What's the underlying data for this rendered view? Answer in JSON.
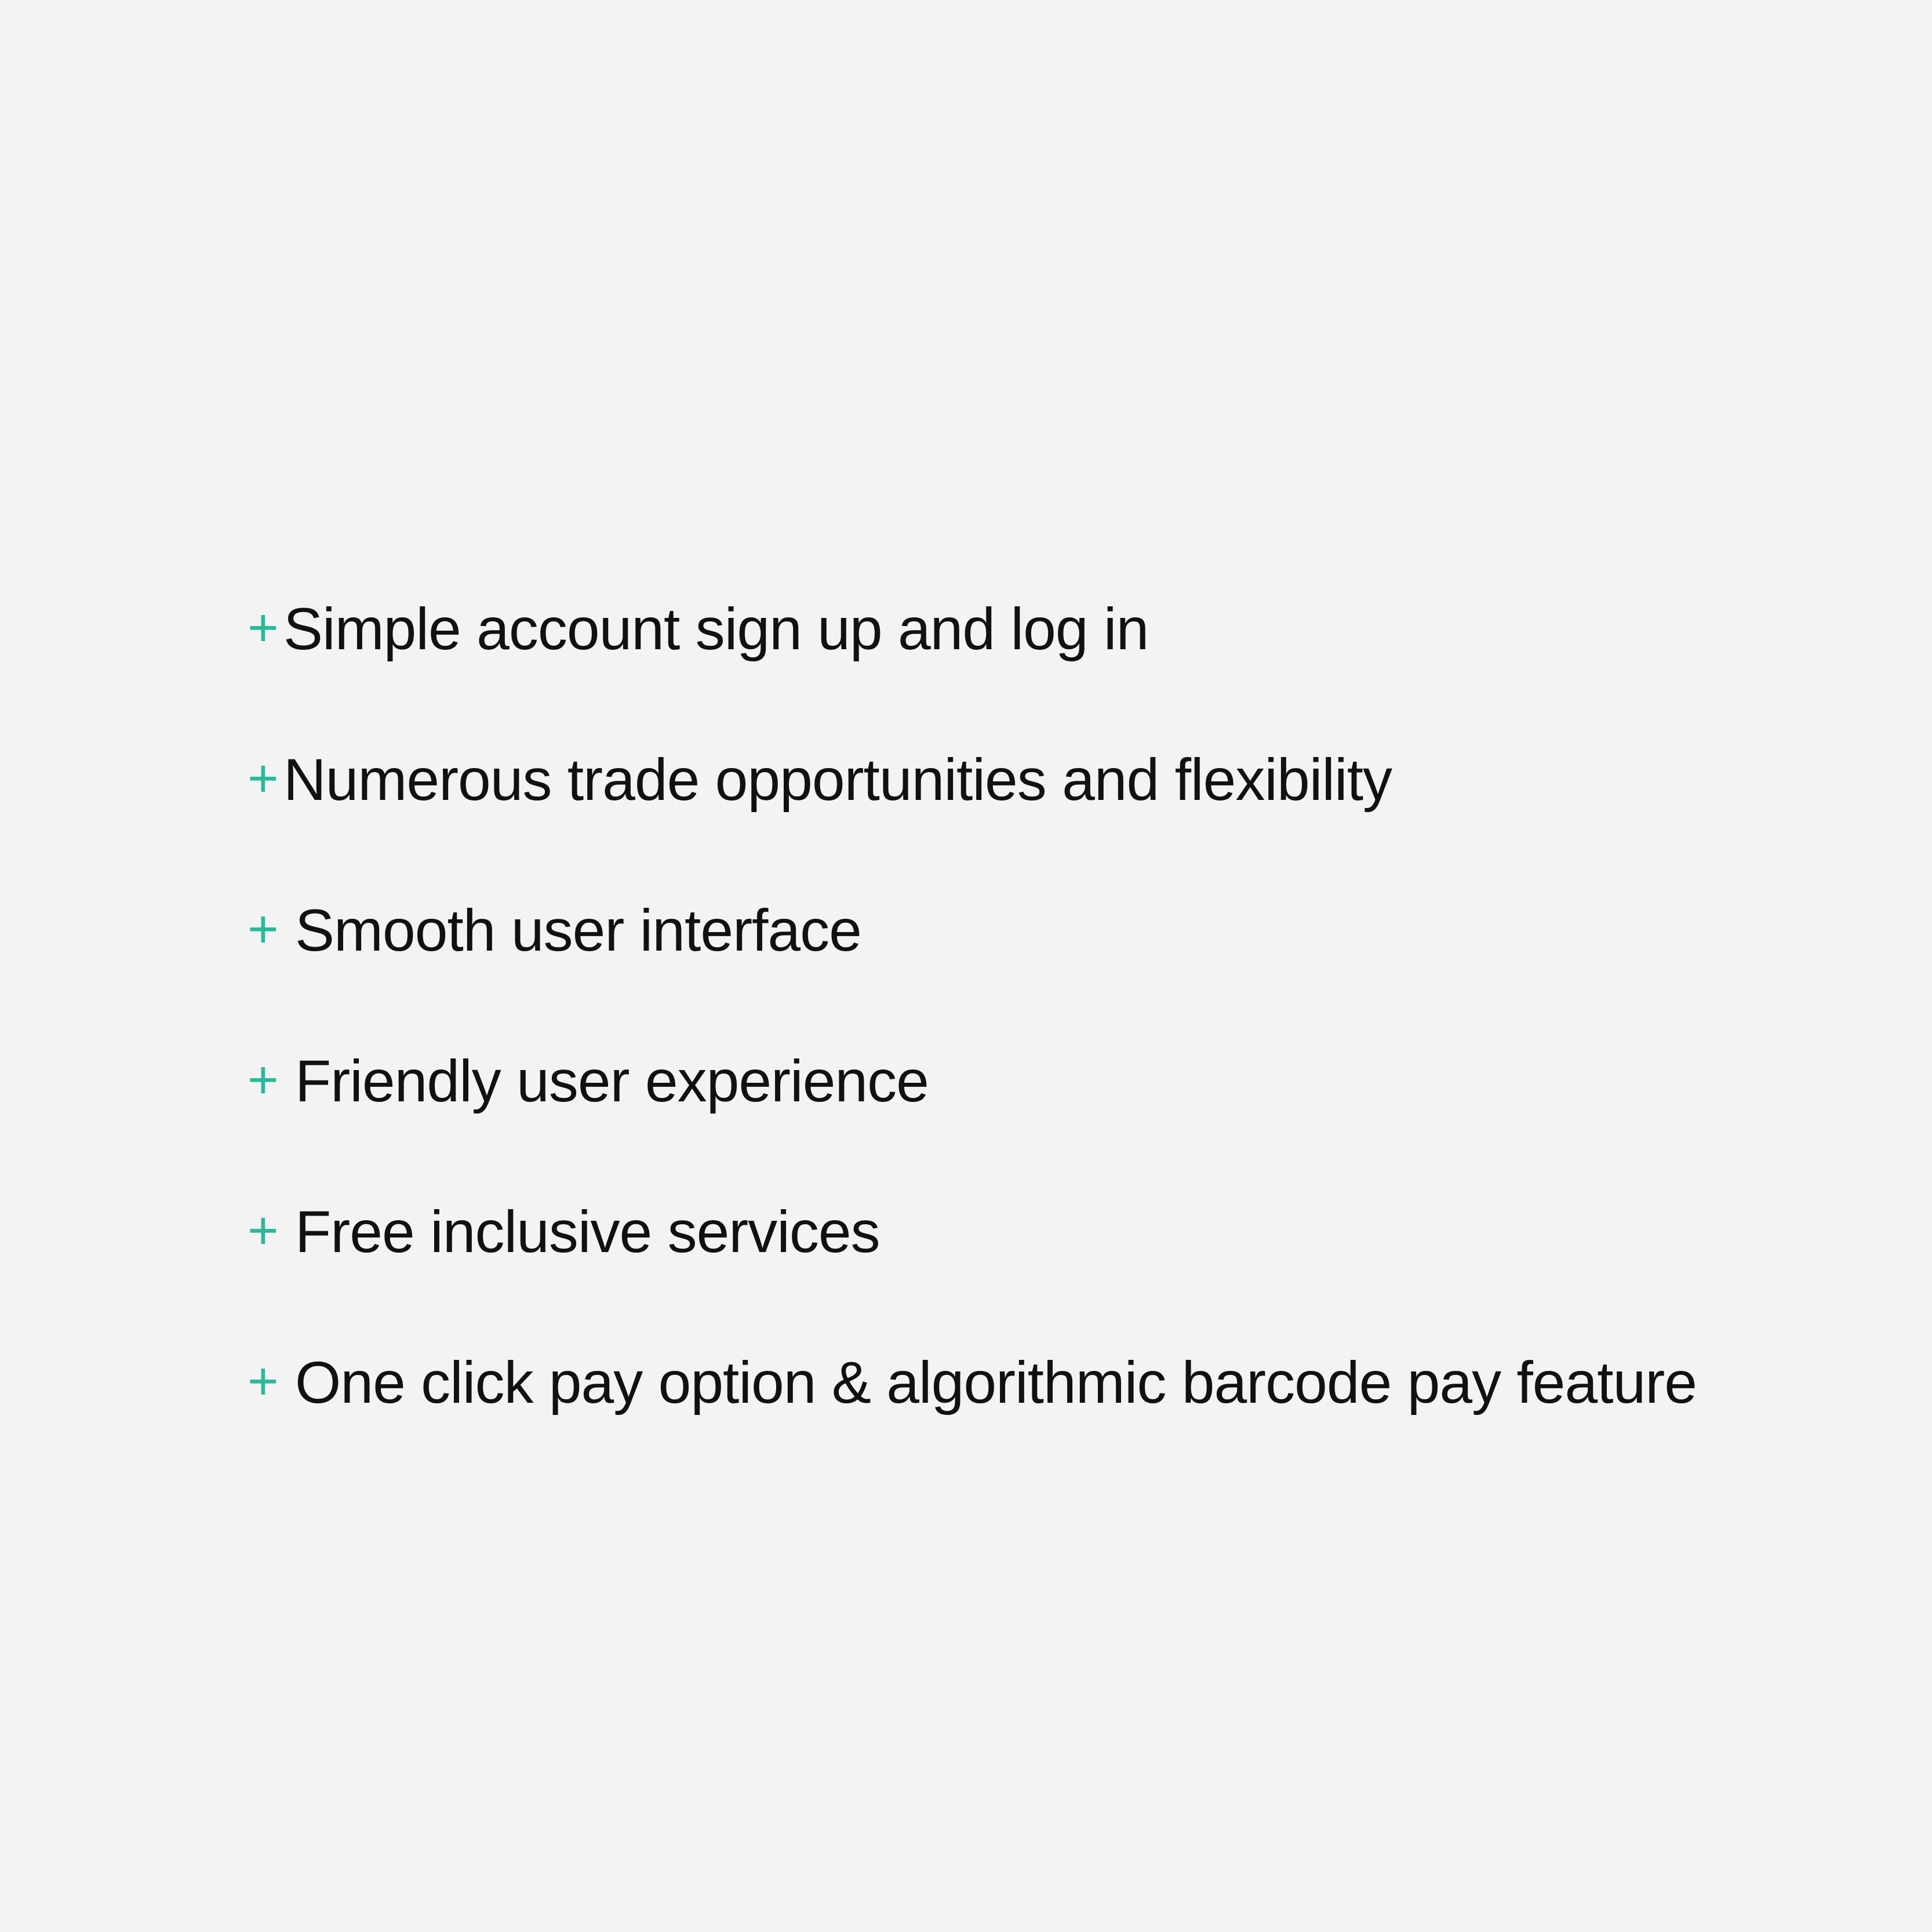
{
  "accent_color": "#28b99a",
  "features": [
    {
      "label": "Simple account sign up and log in",
      "icon": "plus-icon"
    },
    {
      "label": "Numerous trade opportunities and flexibility",
      "icon": "plus-icon"
    },
    {
      "label": "Smooth user interface",
      "icon": "plus-icon"
    },
    {
      "label": "Friendly user experience",
      "icon": "plus-icon"
    },
    {
      "label": "Free inclusive services",
      "icon": "plus-icon"
    },
    {
      "label": "One click pay option & algorithmic barcode pay feature",
      "icon": "plus-icon"
    }
  ]
}
